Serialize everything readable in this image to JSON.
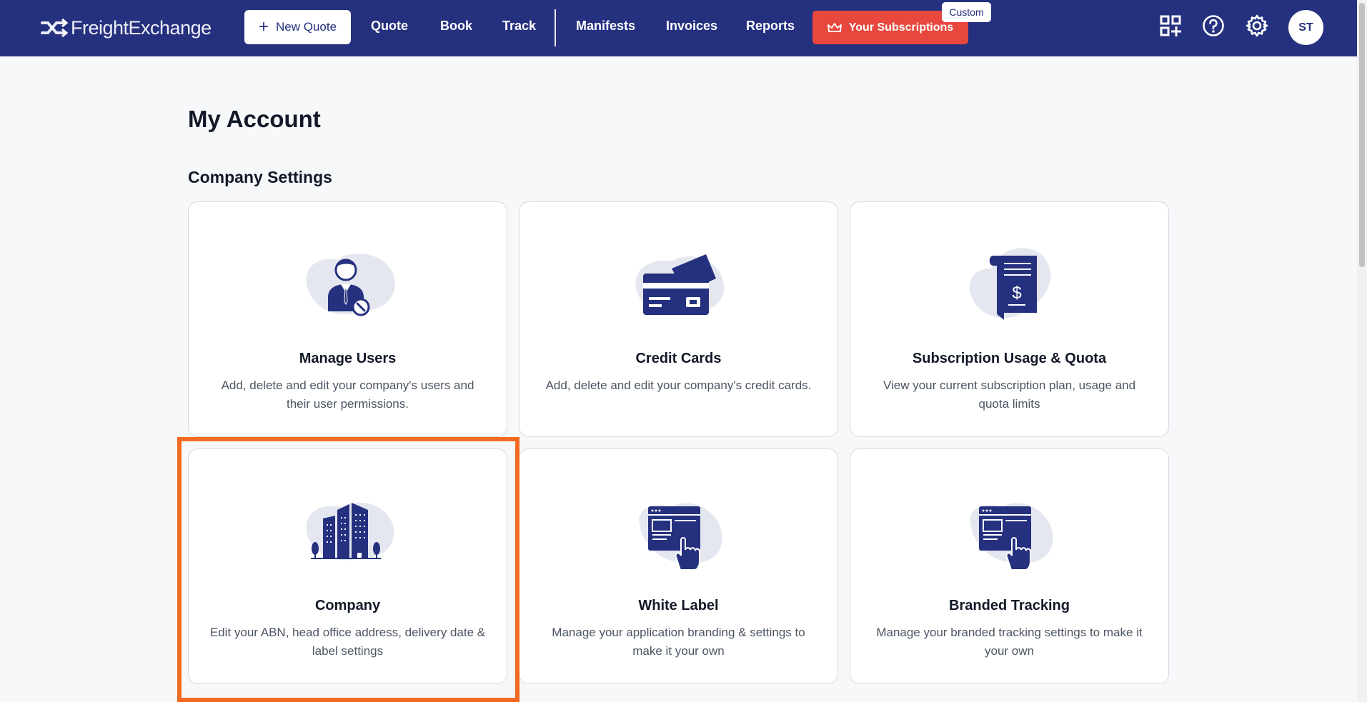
{
  "brand": {
    "name": "FreightExchange"
  },
  "nav": {
    "new_quote": "New Quote",
    "links": [
      "Quote",
      "Book",
      "Track",
      "Manifests",
      "Invoices",
      "Reports"
    ],
    "subscriptions": "Your Subscriptions",
    "custom_badge": "Custom",
    "avatar_initials": "ST",
    "icons": [
      "grid-plus-icon",
      "help-icon",
      "gear-icon"
    ]
  },
  "page": {
    "title": "My Account",
    "section_title": "Company Settings"
  },
  "cards": [
    {
      "title": "Manage Users",
      "description": "Add, delete and edit your company's users and their user permissions.",
      "icon": "user-settings-icon"
    },
    {
      "title": "Credit Cards",
      "description": "Add, delete and edit your company's credit cards.",
      "icon": "credit-card-icon"
    },
    {
      "title": "Subscription Usage & Quota",
      "description": "View your current subscription plan, usage and quota limits",
      "icon": "invoice-dollar-icon"
    },
    {
      "title": "Company",
      "description": "Edit your ABN, head office address, delivery date & label settings",
      "icon": "buildings-icon"
    },
    {
      "title": "White Label",
      "description": "Manage your application branding & settings to make it your own",
      "icon": "browser-click-icon"
    },
    {
      "title": "Branded Tracking",
      "description": "Manage your branded tracking settings to make it your own",
      "icon": "browser-click-icon"
    }
  ],
  "colors": {
    "navy": "#25317f",
    "accent_red": "#e8473d",
    "highlight_orange": "#f26a21",
    "blob": "#e5e7f0"
  }
}
